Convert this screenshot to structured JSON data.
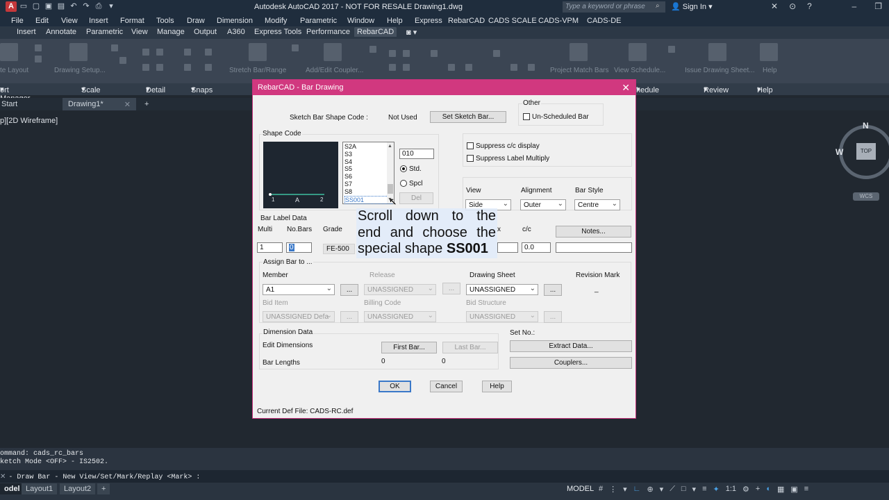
{
  "window": {
    "title": "Autodesk AutoCAD 2017 - NOT FOR RESALE    Drawing1.dwg",
    "search_placeholder": "Type a keyword or phrase",
    "sign_in": "Sign In"
  },
  "menu": [
    "File",
    "Edit",
    "View",
    "Insert",
    "Format",
    "Tools",
    "Draw",
    "Dimension",
    "Modify",
    "Parametric",
    "Window",
    "Help",
    "Express",
    "RebarCAD",
    "CADS SCALE",
    "CADS-VPM",
    "CADS-DE"
  ],
  "ribbon_tabs": [
    "Insert",
    "Annotate",
    "Parametric",
    "View",
    "Manage",
    "Output",
    "A360",
    "Express Tools",
    "Performance",
    "RebarCAD"
  ],
  "ribbon_active_tab": "RebarCAD",
  "ribbon_labels": [
    "Drawing Setup...",
    "Stretch Bar/Range",
    "Add/Edit Coupler...",
    "Project Match Bars",
    "View Schedule...",
    "Issue Drawing Sheet...",
    "Help",
    "te Layout"
  ],
  "ribbon_panels": [
    "ort Manager",
    "Scale",
    "Detail",
    "Snaps",
    "hedule",
    "Review",
    "Help"
  ],
  "file_tabs": [
    "Start",
    "Drawing1*"
  ],
  "viewport_label": "p][2D Wireframe]",
  "viewcube": {
    "north": "N",
    "west": "W",
    "top": "TOP",
    "wcs": "WCS"
  },
  "dialog": {
    "title": "RebarCAD - Bar Drawing",
    "sketch_bar_label": "Sketch Bar Shape Code :",
    "sketch_bar_value": "Not Used",
    "set_sketch_button": "Set Sketch Bar...",
    "other_group": "Other",
    "unscheduled_bar": "Un-Scheduled Bar",
    "shape_code_group": "Shape Code",
    "shape_list": [
      "S2A",
      "S3",
      "S4",
      "S5",
      "S6",
      "S7",
      "S8",
      "SS001"
    ],
    "shape_selected": "SS001",
    "shape_code_input": "010",
    "std_label": "Std.",
    "spcl_label": "Spcl",
    "del_button": "Del",
    "preview_labels": {
      "start": "1",
      "mid": "A",
      "end": "2"
    },
    "suppress_cc": "Suppress c/c display",
    "suppress_label": "Suppress Label Multiply",
    "view_label": "View",
    "view_value": "Side",
    "alignment_label": "Alignment",
    "alignment_value": "Outer",
    "barstyle_label": "Bar Style",
    "barstyle_value": "Centre",
    "bar_label_group": "Bar Label Data",
    "multi_label": "Multi",
    "nobars_label": "No.Bars",
    "grade_label": "Grade",
    "x_label": "x",
    "cc_label": "c/c",
    "notes_button": "Notes...",
    "multi_value": "1",
    "nobars_value": "0",
    "grade_value": "FE-500",
    "cc_value": "0.0",
    "assign_group": "Assign Bar to ...",
    "member_label": "Member",
    "member_value": "A1",
    "release_label": "Release",
    "release_value": "UNASSIGNED",
    "drawing_sheet_label": "Drawing Sheet",
    "drawing_sheet_value": "UNASSIGNED",
    "revision_label": "Revision Mark",
    "revision_value": "_",
    "bid_item_label": "Bid Item",
    "bid_item_value": "UNASSIGNED  Defa",
    "billing_label": "Billing Code",
    "billing_value": "UNASSIGNED",
    "bid_structure_label": "Bid Structure",
    "bid_structure_value": "UNASSIGNED",
    "ellipsis": "...",
    "dimension_group": "Dimension Data",
    "edit_dimensions": "Edit Dimensions",
    "first_bar_button": "First Bar...",
    "last_bar_button": "Last Bar...",
    "bar_lengths": "Bar Lengths",
    "bar_length_first": "0",
    "bar_length_last": "0",
    "set_no_label": "Set No.:",
    "extract_button": "Extract Data...",
    "couplers_button": "Couplers...",
    "ok_button": "OK",
    "cancel_button": "Cancel",
    "help_button": "Help",
    "def_file": "Current Def File: CADS-RC.def"
  },
  "callout": {
    "line1": "Scroll down to the",
    "line2": "end and choose the",
    "line3_prefix": "special shape ",
    "line3_bold": "SS001"
  },
  "command": {
    "history": [
      "ommand: cads_rc_bars",
      "ketch Mode <OFF> - IS2502."
    ],
    "prompt": "- Draw Bar - New View/Set/Mark/Replay <Mark> :"
  },
  "status": {
    "layout_tabs": [
      "odel",
      "Layout1",
      "Layout2"
    ],
    "model": "MODEL",
    "scale": "1:1"
  },
  "colors": {
    "accent": "#d1387f",
    "ribbon": "#3b4553",
    "background": "#212830"
  }
}
